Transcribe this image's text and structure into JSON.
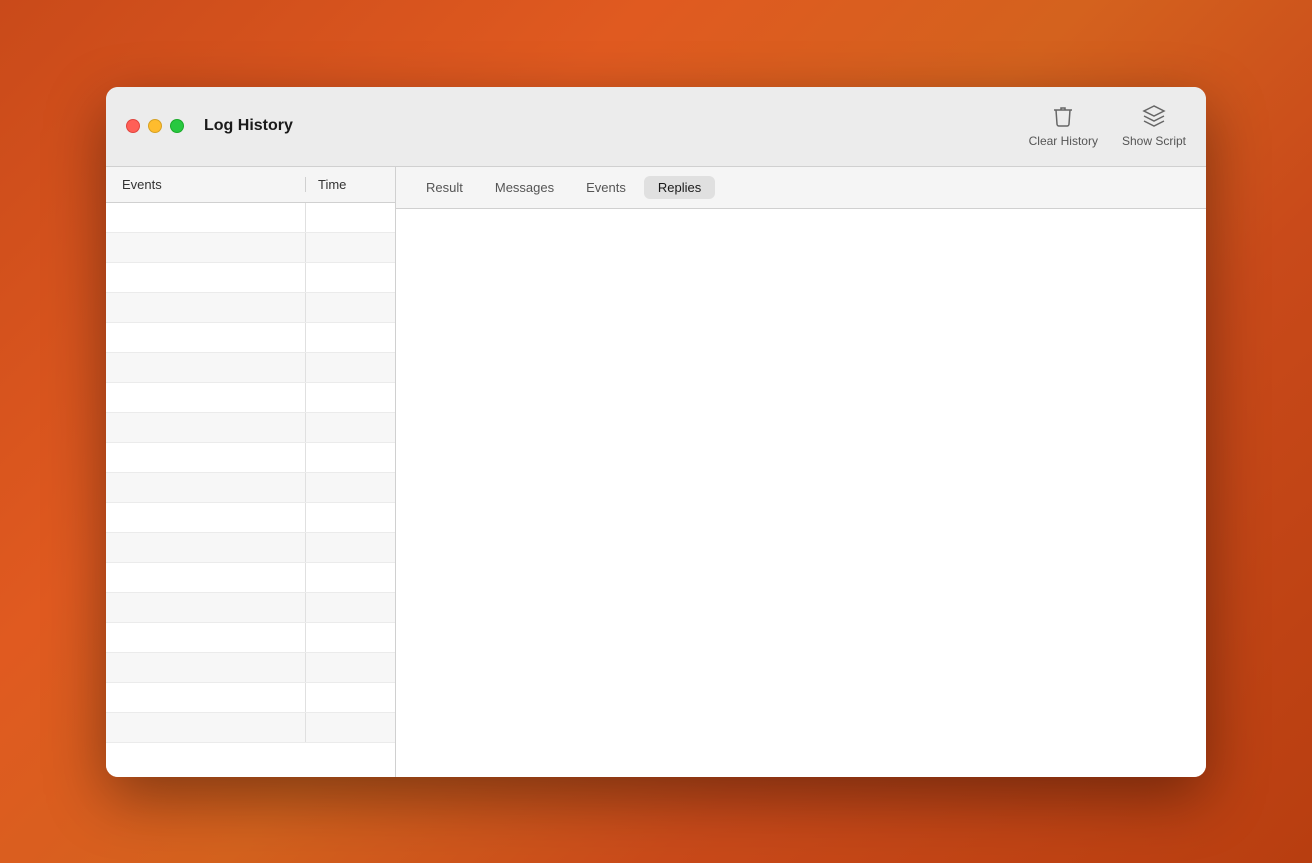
{
  "window": {
    "title": "Log History"
  },
  "toolbar": {
    "clear_history_label": "Clear History",
    "show_script_label": "Show Script"
  },
  "left_panel": {
    "col_events": "Events",
    "col_time": "Time",
    "rows": [
      {},
      {},
      {},
      {},
      {},
      {},
      {},
      {},
      {},
      {},
      {},
      {},
      {},
      {},
      {},
      {},
      {},
      {}
    ]
  },
  "right_panel": {
    "tabs": [
      {
        "id": "result",
        "label": "Result",
        "active": false
      },
      {
        "id": "messages",
        "label": "Messages",
        "active": false
      },
      {
        "id": "events",
        "label": "Events",
        "active": false
      },
      {
        "id": "replies",
        "label": "Replies",
        "active": true
      }
    ]
  }
}
